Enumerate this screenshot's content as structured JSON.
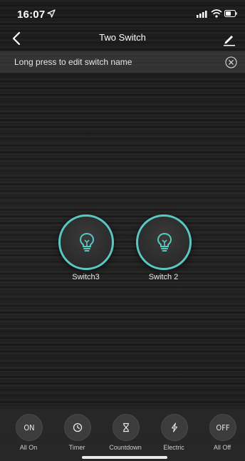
{
  "status_bar": {
    "time": "16:07"
  },
  "nav": {
    "title": "Two Switch"
  },
  "hint": {
    "text": "Long press to edit switch name"
  },
  "switches": [
    {
      "label": "Switch3",
      "state": "on"
    },
    {
      "label": "Switch 2",
      "state": "on"
    }
  ],
  "bottom_bar": {
    "items": [
      {
        "icon_text": "ON",
        "label": "All On"
      },
      {
        "icon": "clock-icon",
        "label": "Timer"
      },
      {
        "icon": "hourglass-icon",
        "label": "Countdown"
      },
      {
        "icon": "lightning-icon",
        "label": "Electric"
      },
      {
        "icon_text": "OFF",
        "label": "All Off"
      }
    ]
  },
  "colors": {
    "accent": "#58c9c2",
    "background": "#1f1f1f"
  }
}
